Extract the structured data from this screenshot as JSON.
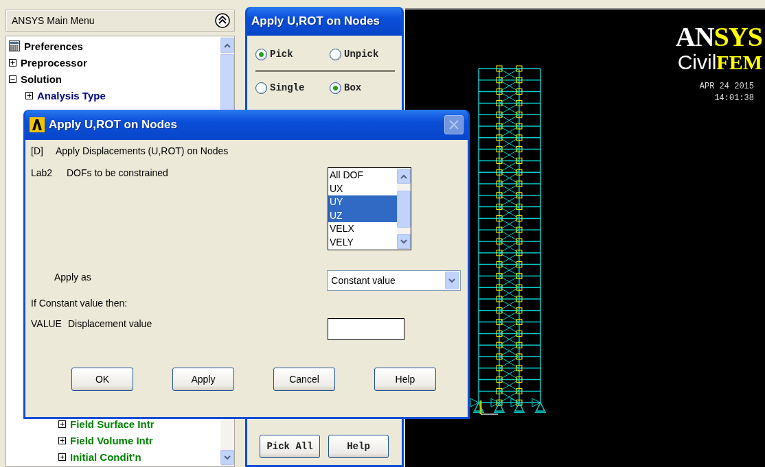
{
  "main_menu": {
    "title": "ANSYS Main Menu",
    "tree": [
      {
        "label": "Preferences",
        "kind": "leaf",
        "color": "#000000"
      },
      {
        "label": "Preprocessor",
        "kind": "branch",
        "expanded": false,
        "color": "#000000"
      },
      {
        "label": "Solution",
        "kind": "branch",
        "expanded": true,
        "color": "#000000",
        "children": [
          {
            "label": "Analysis Type",
            "kind": "branch",
            "expanded": false,
            "color": "#000080"
          }
        ]
      }
    ],
    "tree_tail": [
      {
        "label": "Field Surface Intr",
        "kind": "branch",
        "expanded": false,
        "color": "#008000"
      },
      {
        "label": "Field Volume Intr",
        "kind": "branch",
        "expanded": false,
        "color": "#008000"
      },
      {
        "label": "Initial Condit'n",
        "kind": "branch",
        "expanded": false,
        "color": "#008000"
      }
    ]
  },
  "picker": {
    "title": "Apply U,ROT on Nodes",
    "mode_options": [
      {
        "label": "Pick",
        "selected": true
      },
      {
        "label": "Unpick",
        "selected": false
      }
    ],
    "shape_options": [
      {
        "label": "Single",
        "selected": false
      },
      {
        "label": "Box",
        "selected": true
      }
    ],
    "buttons": [
      "Pick All",
      "Help"
    ]
  },
  "graphics": {
    "logo_line1": [
      {
        "text": "AN",
        "color": "#ffffff"
      },
      {
        "text": "SYS",
        "color": "#ffff00"
      }
    ],
    "logo_line2": [
      {
        "text": "Civil",
        "color": "#ffffff"
      },
      {
        "text": "FEM",
        "color": "#ffff00"
      }
    ],
    "date": "APR 24 2015",
    "time": "14:01:38"
  },
  "dialog": {
    "title": "Apply U,ROT on Nodes",
    "heading_code": "[D]",
    "heading": "Apply Displacements (U,ROT) on Nodes",
    "dof": {
      "code": "Lab2",
      "label": "DOFs to be constrained",
      "options": [
        {
          "label": "All DOF",
          "selected": false
        },
        {
          "label": "UX",
          "selected": false
        },
        {
          "label": "UY",
          "selected": true
        },
        {
          "label": "UZ",
          "selected": true
        },
        {
          "label": "VELX",
          "selected": false
        },
        {
          "label": "VELY",
          "selected": false
        }
      ]
    },
    "apply_as": {
      "label": "Apply as",
      "value": "Constant value"
    },
    "note": "If Constant value then:",
    "value_field": {
      "code": "VALUE",
      "label": "Displacement value"
    },
    "buttons": [
      "OK",
      "Apply",
      "Cancel",
      "Help"
    ]
  }
}
